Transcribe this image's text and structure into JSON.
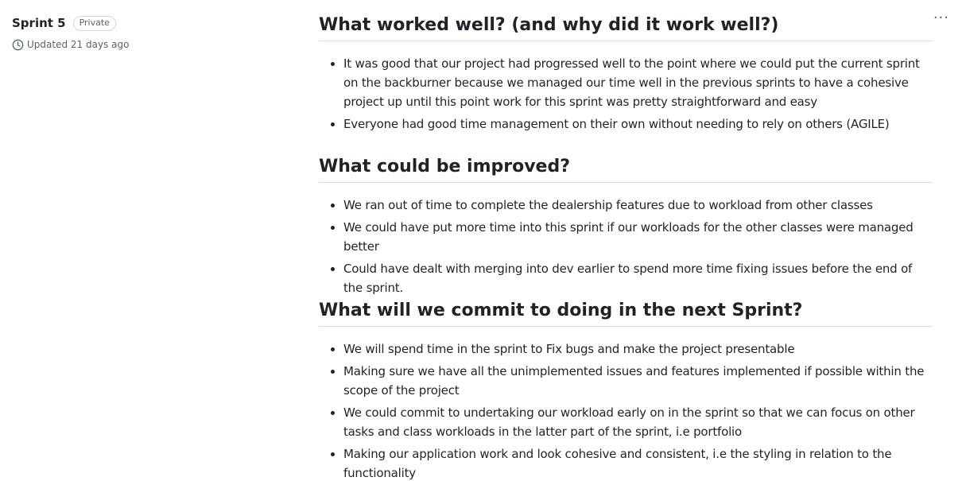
{
  "sidebar": {
    "title": "Sprint 5",
    "visibility_badge": "Private",
    "updated": "Updated 21 days ago"
  },
  "menu": {
    "dots": "···"
  },
  "sections": [
    {
      "heading": "What worked well? (and why did it work well?)",
      "items": [
        "It was good that our project had progressed well to the point where we could put the current sprint on the backburner because we managed our time well in the previous sprints to have a cohesive project up until this point work for this sprint was pretty straightforward and easy",
        "Everyone had good time management on their own without needing to rely on others (AGILE)"
      ]
    },
    {
      "heading": "What could be improved?",
      "items": [
        "We ran out of time to complete the dealership features due to workload from other classes",
        "We could have put more time into this sprint if our workloads for the other classes were managed better",
        "Could have dealt with merging into dev earlier to spend more time fixing issues before the end of the sprint."
      ]
    },
    {
      "heading": "What will we commit to doing in the next Sprint?",
      "items": [
        "We will spend time in the sprint to Fix bugs and make the project presentable",
        "Making sure we have all the unimplemented issues and features implemented if possible within the scope of the project",
        "We could commit to undertaking our workload early on in the sprint so that we can focus on other tasks and class workloads in the latter part of the sprint, i.e portfolio",
        "Making our application work and look cohesive and consistent, i.e the styling in relation to the functionality"
      ]
    }
  ]
}
